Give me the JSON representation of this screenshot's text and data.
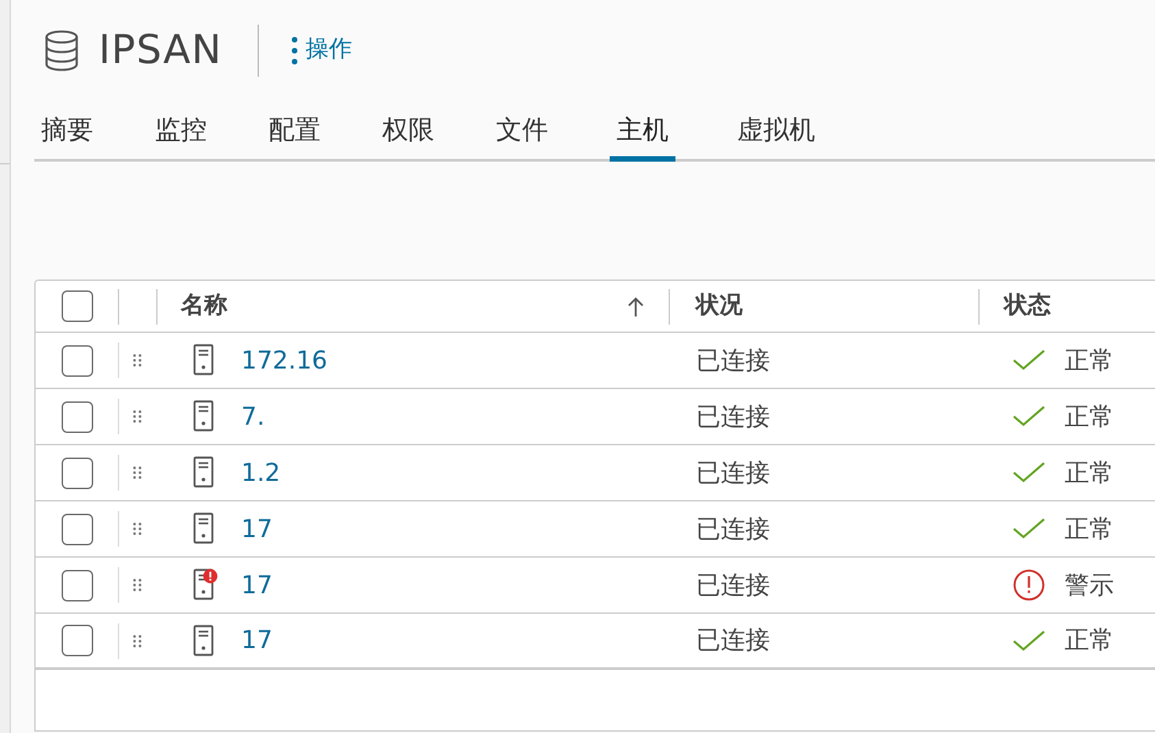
{
  "header": {
    "title": "IPSAN",
    "actions_label": "操作"
  },
  "tabs": [
    {
      "label": "摘要",
      "selected": false
    },
    {
      "label": "监控",
      "selected": false
    },
    {
      "label": "配置",
      "selected": false
    },
    {
      "label": "权限",
      "selected": false
    },
    {
      "label": "文件",
      "selected": false
    },
    {
      "label": "主机",
      "selected": true
    },
    {
      "label": "虚拟机",
      "selected": false
    }
  ],
  "table": {
    "select_all_checked": false,
    "columns": [
      "名称",
      "状况",
      "状态"
    ],
    "sort_ascending": true,
    "rows": [
      {
        "checked": false,
        "name": "172.16",
        "alert": false,
        "condition": "已连接",
        "status": {
          "kind": "ok",
          "label": "正常"
        }
      },
      {
        "checked": false,
        "name": "7.",
        "alert": false,
        "condition": "已连接",
        "status": {
          "kind": "ok",
          "label": "正常"
        }
      },
      {
        "checked": false,
        "name": "1.2",
        "alert": false,
        "condition": "已连接",
        "status": {
          "kind": "ok",
          "label": "正常"
        }
      },
      {
        "checked": false,
        "name": "17",
        "alert": false,
        "condition": "已连接",
        "status": {
          "kind": "ok",
          "label": "正常"
        }
      },
      {
        "checked": false,
        "name": "17",
        "alert": true,
        "condition": "已连接",
        "status": {
          "kind": "warning",
          "label": "警示"
        }
      },
      {
        "checked": false,
        "name": "17",
        "alert": false,
        "condition": "已连接",
        "status": {
          "kind": "ok",
          "label": "正常"
        }
      }
    ]
  }
}
